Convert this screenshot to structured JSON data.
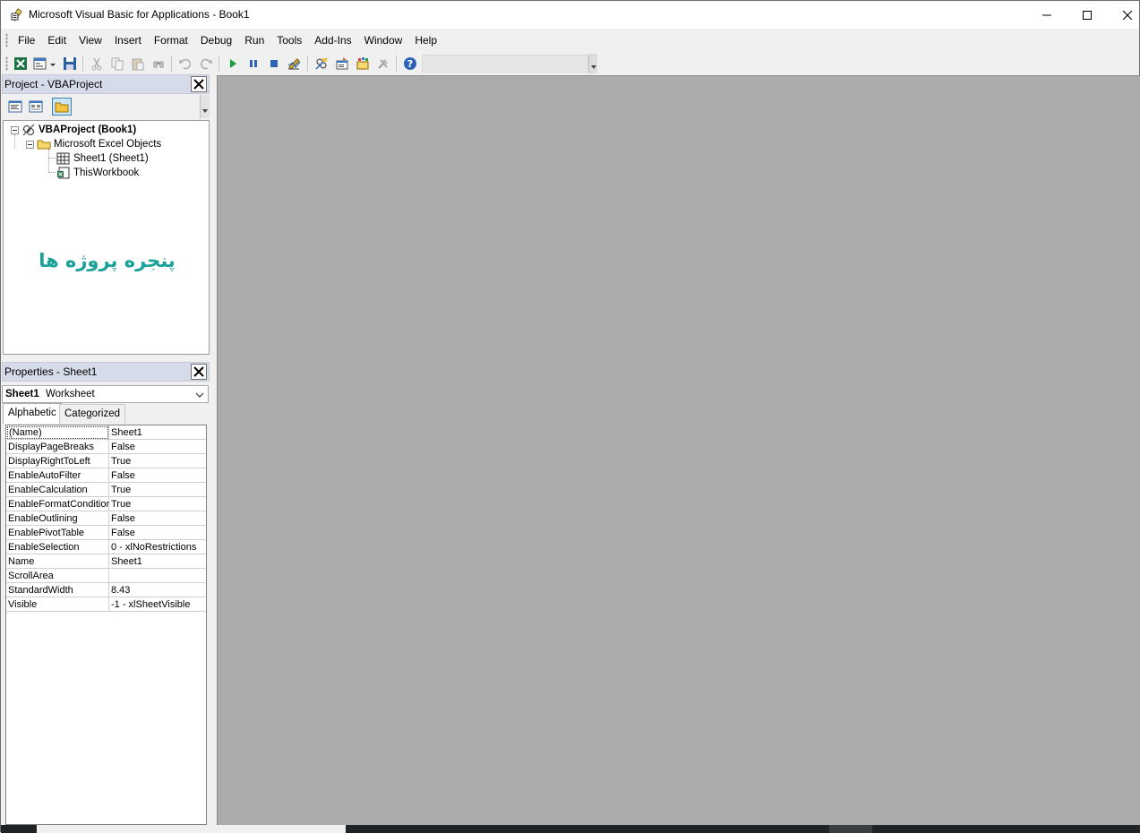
{
  "window": {
    "title": "Microsoft Visual Basic for Applications - Book1"
  },
  "menu": {
    "items": [
      "File",
      "Edit",
      "View",
      "Insert",
      "Format",
      "Debug",
      "Run",
      "Tools",
      "Add-Ins",
      "Window",
      "Help"
    ]
  },
  "toolbar": {
    "icons": [
      "excel-view-icon",
      "insert-userform-icon",
      "save-icon",
      "cut-icon",
      "copy-icon",
      "paste-icon",
      "find-icon",
      "undo-icon",
      "redo-icon",
      "run-icon",
      "break-icon",
      "reset-icon",
      "design-mode-icon",
      "project-explorer-icon",
      "properties-window-icon",
      "object-browser-icon",
      "toolbox-icon",
      "help-icon"
    ]
  },
  "project_panel": {
    "title": "Project - VBAProject",
    "tree": {
      "root": "VBAProject (Book1)",
      "folder": "Microsoft Excel Objects",
      "items": [
        "Sheet1 (Sheet1)",
        "ThisWorkbook"
      ]
    },
    "annotation": "پنجره پروژه ها"
  },
  "properties_panel": {
    "title": "Properties - Sheet1",
    "object_name": "Sheet1",
    "object_type": "Worksheet",
    "tabs": [
      "Alphabetic",
      "Categorized"
    ],
    "rows": [
      {
        "name": "(Name)",
        "value": "Sheet1"
      },
      {
        "name": "DisplayPageBreaks",
        "value": "False"
      },
      {
        "name": "DisplayRightToLeft",
        "value": "True"
      },
      {
        "name": "EnableAutoFilter",
        "value": "False"
      },
      {
        "name": "EnableCalculation",
        "value": "True"
      },
      {
        "name": "EnableFormatConditionsCalculation",
        "value": "True"
      },
      {
        "name": "EnableOutlining",
        "value": "False"
      },
      {
        "name": "EnablePivotTable",
        "value": "False"
      },
      {
        "name": "EnableSelection",
        "value": "0 - xlNoRestrictions"
      },
      {
        "name": "Name",
        "value": "Sheet1"
      },
      {
        "name": "ScrollArea",
        "value": ""
      },
      {
        "name": "StandardWidth",
        "value": "8.43"
      },
      {
        "name": "Visible",
        "value": "-1 - xlSheetVisible"
      }
    ]
  },
  "colors": {
    "workspace": "#ababab",
    "panel_header": "#d6dbe9",
    "annotation": "#1aa198"
  }
}
